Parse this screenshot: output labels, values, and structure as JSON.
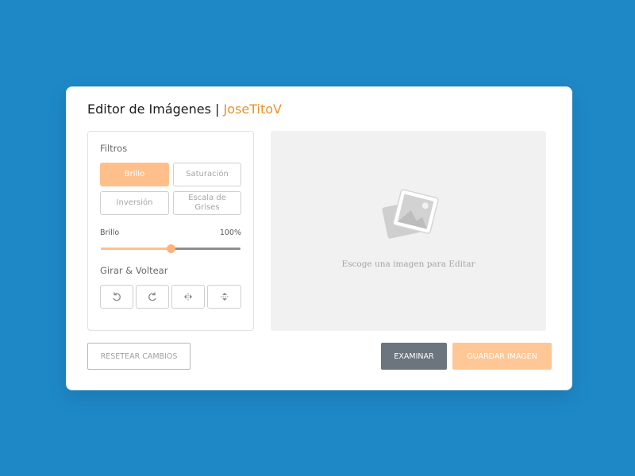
{
  "header": {
    "title": "Editor de Imágenes",
    "separator": "|",
    "brand": "JoseTitoV",
    "brand_color": "#e8922e"
  },
  "filters": {
    "label": "Filtros",
    "buttons": [
      {
        "label": "Brillo",
        "active": true
      },
      {
        "label": "Saturación",
        "active": false
      },
      {
        "label": "Inversión",
        "active": false
      },
      {
        "label": "Escala de Grises",
        "active": false
      }
    ],
    "slider": {
      "name": "Brillo",
      "value_text": "100%",
      "level": 0.5
    }
  },
  "rotate": {
    "label": "Girar & Voltear",
    "buttons": [
      {
        "icon": "rotate-left-icon"
      },
      {
        "icon": "rotate-right-icon"
      },
      {
        "icon": "flip-horizontal-icon"
      },
      {
        "icon": "flip-vertical-icon"
      }
    ]
  },
  "preview": {
    "placeholder_text": "Escoge una imagen para Editar",
    "icon": "image-placeholder-icon"
  },
  "footer": {
    "reset_label": "RESETEAR CAMBIOS",
    "browse_label": "EXAMINAR",
    "save_label": "GUARDAR IMAGEN"
  },
  "colors": {
    "background": "#1e88c7",
    "accent": "#ffbf8a",
    "secondary": "#6c757d"
  }
}
